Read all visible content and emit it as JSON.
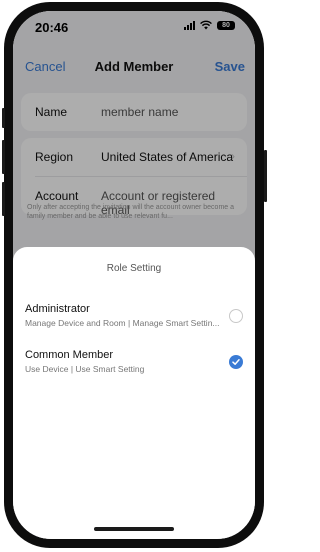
{
  "status_bar": {
    "time": "20:46",
    "battery": "80"
  },
  "nav": {
    "cancel": "Cancel",
    "title": "Add Member",
    "save": "Save"
  },
  "form": {
    "name": {
      "label": "Name",
      "placeholder": "member name"
    },
    "region": {
      "label": "Region",
      "value": "United States of America"
    },
    "account": {
      "label": "Account",
      "placeholder": "Account or registered email"
    },
    "note": "Only after accepting the invitation will the account owner become a family member and be able to use relevant fu..."
  },
  "sheet": {
    "title": "Role Setting",
    "options": [
      {
        "title": "Administrator",
        "subtitle": "Manage Device and Room | Manage Smart Settin...",
        "selected": false
      },
      {
        "title": "Common Member",
        "subtitle": "Use Device | Use Smart Setting",
        "selected": true
      }
    ]
  },
  "colors": {
    "accent": "#3a7bd5"
  }
}
